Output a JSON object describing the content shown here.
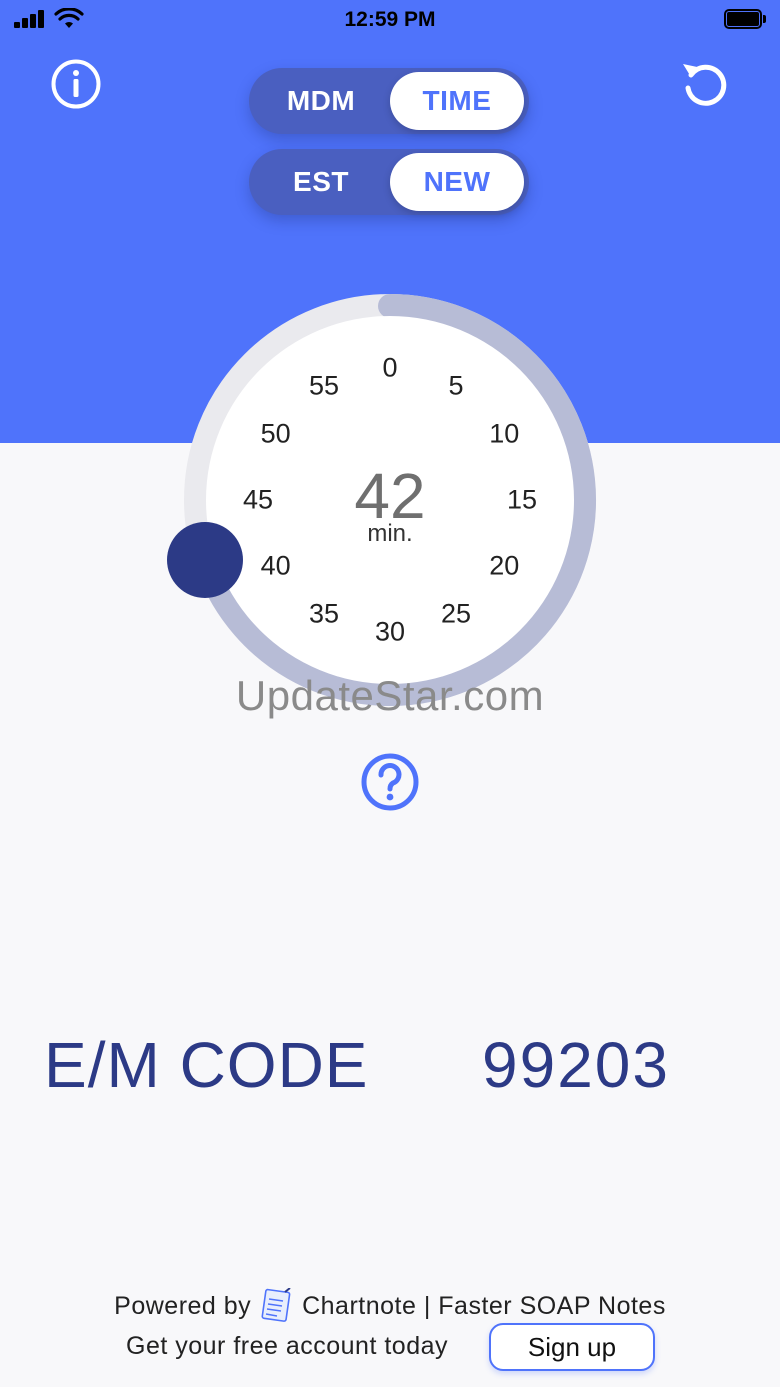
{
  "status_bar": {
    "time": "12:59 PM"
  },
  "header": {
    "info_icon": "info-circle-icon",
    "reset_icon": "undo-icon",
    "mode_toggle": {
      "options": [
        "MDM",
        "TIME"
      ],
      "selected": "TIME"
    },
    "patient_toggle": {
      "options": [
        "EST",
        "NEW"
      ],
      "selected": "NEW"
    }
  },
  "dial": {
    "ticks": [
      "0",
      "5",
      "10",
      "15",
      "20",
      "25",
      "30",
      "35",
      "40",
      "45",
      "50",
      "55"
    ],
    "value": "42",
    "unit": "min.",
    "max_minutes": 60
  },
  "watermark": "UpdateStar.com",
  "help_icon": "question-circle-icon",
  "result": {
    "label": "E/M CODE",
    "code": "99203"
  },
  "footer": {
    "powered_prefix": "Powered by",
    "brand": "Chartnote | Faster SOAP Notes",
    "cta_text": "Get your free account today",
    "signup_label": "Sign up"
  },
  "colors": {
    "primary": "#4f73fb",
    "dark_accent": "#2c3a86",
    "track": "#b7bcd6",
    "background": "#f8f8fa"
  }
}
